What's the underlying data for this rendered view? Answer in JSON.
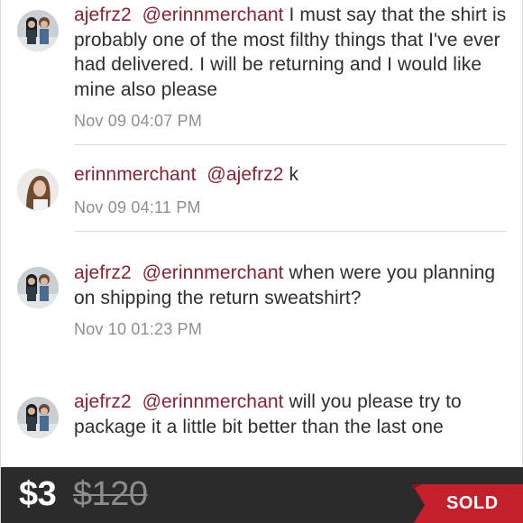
{
  "comments": [
    {
      "user": "ajefrz2",
      "mention": "@erinnmerchant",
      "text": " I must say that the shirt is probably one of the most filthy things that I've ever had delivered. I will be returning and I would like mine also please",
      "timestamp": "Nov 09 04:07 PM",
      "avatar": "avatar-two-people-icon"
    },
    {
      "user": "erinnmerchant",
      "mention": "@ajefrz2",
      "text": " k",
      "timestamp": "Nov 09 04:11 PM",
      "avatar": "avatar-selfie-icon"
    },
    {
      "user": "ajefrz2",
      "mention": "@erinnmerchant",
      "text": " when were you planning on shipping the return sweatshirt?",
      "timestamp": "Nov 10 01:23 PM",
      "avatar": "avatar-two-people-icon"
    },
    {
      "user": "ajefrz2",
      "mention": "@erinnmerchant",
      "text": " will you please try to package it a little bit better than the last one",
      "timestamp": "",
      "avatar": "avatar-two-people-icon"
    }
  ],
  "listing": {
    "price": "$3",
    "original_price": "$120",
    "status": "SOLD"
  },
  "colors": {
    "username": "#8a2232",
    "timestamp": "#8f8f8f",
    "price_bar": "#2b2b2b",
    "sold_ribbon": "#c3202b"
  }
}
